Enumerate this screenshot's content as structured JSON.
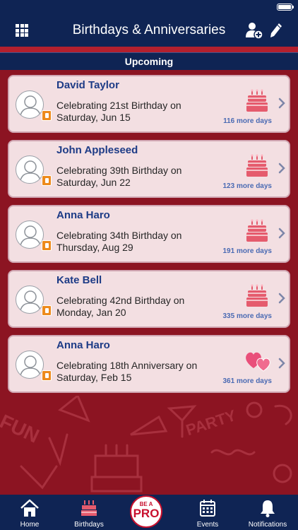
{
  "header": {
    "title": "Birthdays & Anniversaries"
  },
  "section": {
    "title": "Upcoming"
  },
  "events": [
    {
      "name": "David Taylor",
      "line1": "Celebrating 21st Birthday on",
      "line2": "Saturday, Jun 15",
      "days": "116 more days",
      "type": "birthday"
    },
    {
      "name": "John Appleseed",
      "line1": "Celebrating 39th Birthday on",
      "line2": "Saturday, Jun 22",
      "days": "123 more days",
      "type": "birthday"
    },
    {
      "name": "Anna Haro",
      "line1": "Celebrating 34th Birthday on",
      "line2": "Thursday, Aug 29",
      "days": "191 more days",
      "type": "birthday"
    },
    {
      "name": "Kate Bell",
      "line1": "Celebrating 42nd Birthday on",
      "line2": "Monday, Jan 20",
      "days": "335 more days",
      "type": "birthday"
    },
    {
      "name": "Anna Haro",
      "line1": "Celebrating 18th Anniversary on",
      "line2": "Saturday, Feb 15",
      "days": "361 more days",
      "type": "anniversary"
    }
  ],
  "tabs": {
    "home": "Home",
    "birthdays": "Birthdays",
    "pro_top": "BE A",
    "pro_main": "PRO",
    "events": "Events",
    "notifications": "Notifications"
  },
  "background_text": {
    "fun": "FUN",
    "party": "PARTY"
  },
  "colors": {
    "navy": "#0f2454",
    "red": "#8c1422",
    "card": "#f3dfe2",
    "name": "#1d3b86",
    "days": "#4a6ab3",
    "accent": "#c8102e"
  },
  "icons": {
    "menu": "grid-icon",
    "add_user": "add-user-icon",
    "edit": "pencil-icon",
    "birthday": "cake-icon",
    "anniversary": "hearts-icon",
    "more": "chevron-right-icon",
    "contact": "contact-badge-icon"
  }
}
